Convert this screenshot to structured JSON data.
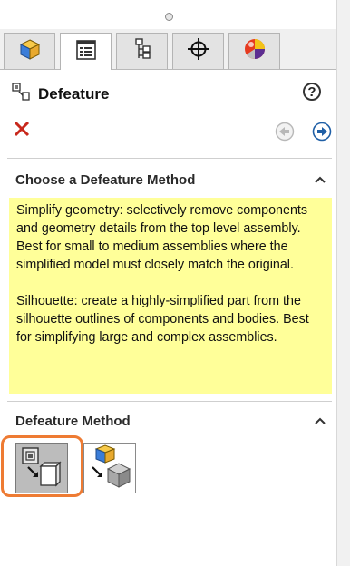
{
  "panel": {
    "title": "Defeature",
    "help_label": "?"
  },
  "tabs": [
    {
      "icon": "feature-manager-icon",
      "active": false
    },
    {
      "icon": "property-manager-icon",
      "active": true
    },
    {
      "icon": "configuration-manager-icon",
      "active": false
    },
    {
      "icon": "dimxpert-manager-icon",
      "active": false
    },
    {
      "icon": "display-manager-icon",
      "active": false
    }
  ],
  "actions": {
    "cancel_icon": "close-icon",
    "back_icon": "back-arrow-icon",
    "next_icon": "next-arrow-icon"
  },
  "section_choose": {
    "title": "Choose a Defeature Method",
    "tip_paragraphs": [
      "Simplify geometry: selectively remove components and geometry details from the top level assembly. Best for small to medium assemblies where the simplified model must closely match the original.",
      "Silhouette: create a highly-simplified part from the silhouette outlines of components and bodies. Best for simplifying large and complex assemblies."
    ]
  },
  "section_method": {
    "title": "Defeature Method",
    "options": [
      {
        "name": "simplify-geometry",
        "selected": true
      },
      {
        "name": "silhouette",
        "selected": false
      }
    ]
  },
  "colors": {
    "tip_background": "#ffff99",
    "highlight": "#ee7b33",
    "cancel": "#c8281c",
    "next_arrow": "#1f5fa6"
  }
}
